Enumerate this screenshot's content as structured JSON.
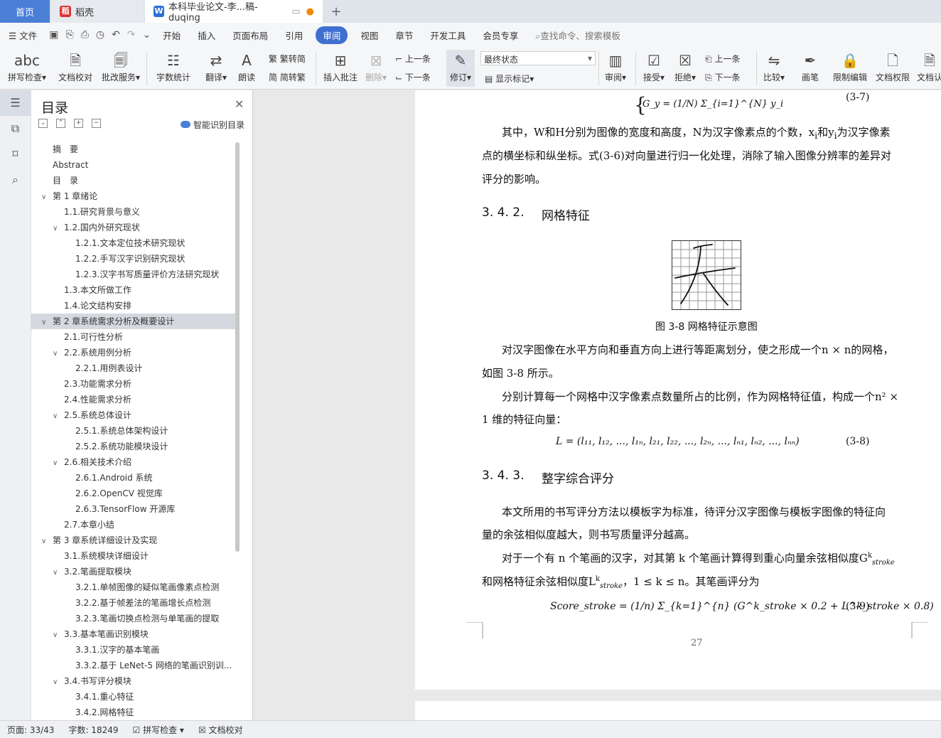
{
  "tabs": {
    "home": "首页",
    "daoke": "稻壳",
    "doc": "本科毕业论文-李...稿-duqing"
  },
  "menu": [
    "文件",
    "开始",
    "插入",
    "页面布局",
    "引用",
    "审阅",
    "视图",
    "章节",
    "开发工具",
    "会员专享"
  ],
  "menu_active": "审阅",
  "search": "查找命令、搜索模板",
  "ribbon": {
    "spell": "拼写检查",
    "proof": "文档校对",
    "annotate": "批改服务",
    "wordcount": "字数统计",
    "translate": "翻译",
    "read": "朗读",
    "t2s": "繁转简",
    "s2t": "简转繁",
    "insert_comment": "插入批注",
    "delete": "删除",
    "prev": "上一条",
    "next": "下一条",
    "revise": "修订",
    "state": "最终状态",
    "show_marks": "显示标记",
    "review": "审阅",
    "accept": "接受",
    "reject": "拒绝",
    "prev2": "上一条",
    "next2": "下一条",
    "compare": "比较",
    "pen": "画笔",
    "restrict": "限制编辑",
    "perm": "文档权限",
    "auth": "文档认"
  },
  "toc": {
    "title": "目录",
    "smart": "智能识别目录",
    "items": [
      {
        "t": "摘　要",
        "l": 0,
        "a": ""
      },
      {
        "t": "Abstract",
        "l": 0,
        "a": ""
      },
      {
        "t": "目　录",
        "l": 0,
        "a": ""
      },
      {
        "t": "第 1 章绪论",
        "l": 0,
        "a": "v"
      },
      {
        "t": "1.1.研究背景与意义",
        "l": 1,
        "a": ""
      },
      {
        "t": "1.2.国内外研究现状",
        "l": 1,
        "a": "v"
      },
      {
        "t": "1.2.1.文本定位技术研究现状",
        "l": 2,
        "a": ""
      },
      {
        "t": "1.2.2.手写汉字识别研究现状",
        "l": 2,
        "a": ""
      },
      {
        "t": "1.2.3.汉字书写质量评价方法研究现状",
        "l": 2,
        "a": ""
      },
      {
        "t": "1.3.本文所做工作",
        "l": 1,
        "a": ""
      },
      {
        "t": "1.4.论文结构安排",
        "l": 1,
        "a": ""
      },
      {
        "t": "第 2 章系统需求分析及概要设计",
        "l": 0,
        "a": "v",
        "hl": true
      },
      {
        "t": "2.1.可行性分析",
        "l": 1,
        "a": ""
      },
      {
        "t": "2.2.系统用例分析",
        "l": 1,
        "a": "v"
      },
      {
        "t": "2.2.1.用例表设计",
        "l": 2,
        "a": ""
      },
      {
        "t": "2.3.功能需求分析",
        "l": 1,
        "a": ""
      },
      {
        "t": "2.4.性能需求分析",
        "l": 1,
        "a": ""
      },
      {
        "t": "2.5.系统总体设计",
        "l": 1,
        "a": "v"
      },
      {
        "t": "2.5.1.系统总体架构设计",
        "l": 2,
        "a": ""
      },
      {
        "t": "2.5.2.系统功能模块设计",
        "l": 2,
        "a": ""
      },
      {
        "t": "2.6.相关技术介绍",
        "l": 1,
        "a": "v"
      },
      {
        "t": "2.6.1.Android 系统",
        "l": 2,
        "a": ""
      },
      {
        "t": "2.6.2.OpenCV 视觉库",
        "l": 2,
        "a": ""
      },
      {
        "t": "2.6.3.TensorFlow 开源库",
        "l": 2,
        "a": ""
      },
      {
        "t": "2.7.本章小结",
        "l": 1,
        "a": ""
      },
      {
        "t": "第 3 章系统详细设计及实现",
        "l": 0,
        "a": "v"
      },
      {
        "t": "3.1.系统模块详细设计",
        "l": 1,
        "a": ""
      },
      {
        "t": "3.2.笔画提取模块",
        "l": 1,
        "a": "v"
      },
      {
        "t": "3.2.1.单帧图像的疑似笔画像素点检测",
        "l": 2,
        "a": ""
      },
      {
        "t": "3.2.2.基于帧差法的笔画增长点检测",
        "l": 2,
        "a": ""
      },
      {
        "t": "3.2.3.笔画切换点检测与单笔画的提取",
        "l": 2,
        "a": ""
      },
      {
        "t": "3.3.基本笔画识别模块",
        "l": 1,
        "a": "v"
      },
      {
        "t": "3.3.1.汉字的基本笔画",
        "l": 2,
        "a": ""
      },
      {
        "t": "3.3.2.基于 LeNet-5 网络的笔画识别训...",
        "l": 2,
        "a": ""
      },
      {
        "t": "3.4.书写评分模块",
        "l": 1,
        "a": "v"
      },
      {
        "t": "3.4.1.重心特征",
        "l": 2,
        "a": ""
      },
      {
        "t": "3.4.2.网格特征",
        "l": 2,
        "a": ""
      }
    ]
  },
  "doc": {
    "eq37_top": "G_y = (1/N) Σ_{i=1}^{N} y_i",
    "eq37_num": "(3-7)",
    "p1a": "其中，W和H分别为图像的宽度和高度，N为汉字像素点的个数，x",
    "p1b": "和y",
    "p1c": "为汉字像素",
    "p1d": "点的横坐标和纵坐标。式(3-6)对向量进行归一化处理，消除了输入图像分辨率的差异对",
    "p1e": "评分的影响。",
    "h342_num": "3. 4. 2.",
    "h342": "网格特征",
    "cap38": "图 3-8  网格特征示意图",
    "p2a": "对汉字图像在水平方向和垂直方向上进行等距离划分，使之形成一个n × n的网格，",
    "p2b": "如图 3-8 所示。",
    "p3a": "分别计算每一个网格中汉字像素点数量所占的比例，作为网格特征值，构成一个n² ×",
    "p3b": "1 维的特征向量：",
    "eq38": "L = (l₁₁, l₁₂, ..., l₁ₙ, l₂₁, l₂₂, ..., l₂ₙ, ..., lₙ₁, lₙ₂, ..., lₙₙ)",
    "eq38_num": "(3-8)",
    "h343_num": "3. 4. 3.",
    "h343": "整字综合评分",
    "p4a": "本文所用的书写评分方法以模板字为标准，待评分汉字图像与模板字图像的特征向",
    "p4b": "量的余弦相似度越大，则书写质量评分越高。",
    "p5a": "对于一个有 n 个笔画的汉字，对其第 k 个笔画计算得到重心向量余弦相似度G",
    "p5b": "和网格特征余弦相似度L",
    "p5c": "，1 ≤ k ≤ n。其笔画评分为",
    "eq39": "Score_stroke = (1/n) Σ_{k=1}^{n} (G^k_stroke × 0.2 + L^k_stroke × 0.8)",
    "eq39_num": "(3-9)",
    "page": "27"
  },
  "status": {
    "page": "页面: 33/43",
    "words": "字数: 18249",
    "spell": "拼写检查",
    "proof": "文档校对"
  }
}
